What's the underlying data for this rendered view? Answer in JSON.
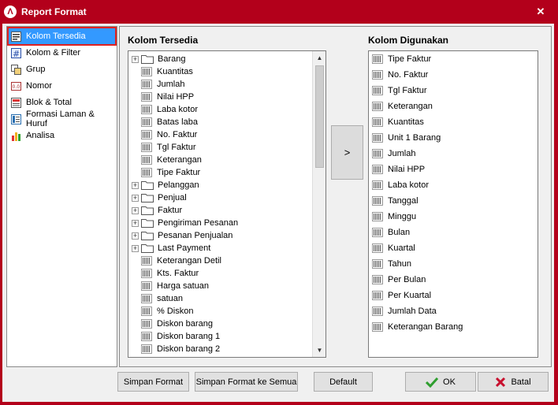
{
  "window": {
    "title": "Report Format",
    "close_glyph": "✕"
  },
  "nav": {
    "items": [
      {
        "label": "Kolom Tersedia",
        "icon": "list-icon"
      },
      {
        "label": "Kolom & Filter",
        "icon": "filter-icon"
      },
      {
        "label": "Grup",
        "icon": "group-icon"
      },
      {
        "label": "Nomor",
        "icon": "number-icon"
      },
      {
        "label": "Blok & Total",
        "icon": "block-icon"
      },
      {
        "label": "Formasi Laman & Huruf",
        "icon": "page-format-icon"
      },
      {
        "label": "Analisa",
        "icon": "chart-icon"
      }
    ],
    "selected_index": 0
  },
  "available": {
    "heading": "Kolom Tersedia",
    "items": [
      {
        "label": "Barang",
        "type": "folder"
      },
      {
        "label": "Kuantitas",
        "type": "column"
      },
      {
        "label": "Jumlah",
        "type": "column"
      },
      {
        "label": "Nilai HPP",
        "type": "column"
      },
      {
        "label": "Laba kotor",
        "type": "column"
      },
      {
        "label": "Batas laba",
        "type": "column"
      },
      {
        "label": "No. Faktur",
        "type": "column"
      },
      {
        "label": "Tgl Faktur",
        "type": "column"
      },
      {
        "label": "Keterangan",
        "type": "column"
      },
      {
        "label": "Tipe Faktur",
        "type": "column"
      },
      {
        "label": "Pelanggan",
        "type": "folder"
      },
      {
        "label": "Penjual",
        "type": "folder"
      },
      {
        "label": "Faktur",
        "type": "folder"
      },
      {
        "label": "Pengiriman Pesanan",
        "type": "folder"
      },
      {
        "label": "Pesanan Penjualan",
        "type": "folder"
      },
      {
        "label": "Last Payment",
        "type": "folder"
      },
      {
        "label": "Keterangan Detil",
        "type": "column"
      },
      {
        "label": "Kts. Faktur",
        "type": "column"
      },
      {
        "label": "Harga satuan",
        "type": "column"
      },
      {
        "label": "satuan",
        "type": "column"
      },
      {
        "label": "% Diskon",
        "type": "column"
      },
      {
        "label": "Diskon barang",
        "type": "column"
      },
      {
        "label": "Diskon barang 1",
        "type": "column"
      },
      {
        "label": "Diskon barang 2",
        "type": "column"
      }
    ]
  },
  "move_button": {
    "label": ">"
  },
  "used": {
    "heading": "Kolom Digunakan",
    "items": [
      "Tipe Faktur",
      "No. Faktur",
      "Tgl Faktur",
      "Keterangan",
      "Kuantitas",
      "Unit 1 Barang",
      "Jumlah",
      "Nilai HPP",
      "Laba kotor",
      "Tanggal",
      "Minggu",
      "Bulan",
      "Kuartal",
      "Tahun",
      "Per Bulan",
      "Per Kuartal",
      "Jumlah Data",
      "Keterangan Barang"
    ]
  },
  "buttons": {
    "save_format": "Simpan Format",
    "save_format_all": "Simpan Format ke Semua",
    "default": "Default",
    "ok": "OK",
    "cancel": "Batal"
  },
  "colors": {
    "titlebar": "#b3001b",
    "selection": "#3399ff",
    "ok_check": "#2e9e2e",
    "cancel_x": "#c8102e"
  }
}
